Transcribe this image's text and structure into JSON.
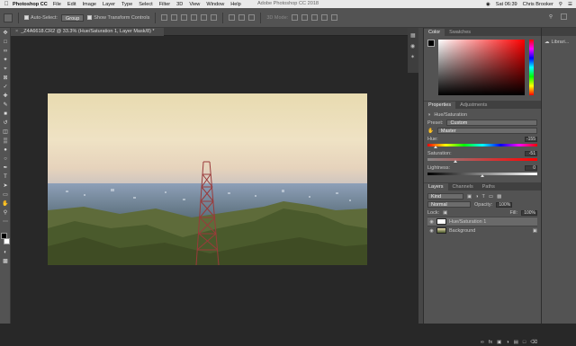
{
  "menubar": {
    "apple": "",
    "app_name": "Photoshop CC",
    "items": [
      "File",
      "Edit",
      "Image",
      "Layer",
      "Type",
      "Select",
      "Filter",
      "3D",
      "View",
      "Window",
      "Help"
    ],
    "center_title": "Adobe Photoshop CC 2018",
    "clock": "Sat 06:39",
    "user": "Chris Brooker"
  },
  "options": {
    "auto_select_label": "Auto-Select:",
    "auto_select_value": "Group",
    "transform_label": "Show Transform Controls",
    "mode_3d": "3D Mode:"
  },
  "document": {
    "tab_title": "_Z4A6618.CR2 @ 33.3% (Hue/Saturation 1, Layer Mask/8) *"
  },
  "color_panel": {
    "tabs": [
      "Color",
      "Swatches"
    ]
  },
  "properties_panel": {
    "tabs": [
      "Properties",
      "Adjustments"
    ],
    "adjustment_name": "Hue/Saturation",
    "preset_label": "Preset:",
    "preset_value": "Custom",
    "channel_value": "Master",
    "hue_label": "Hue:",
    "hue_value": "-155",
    "hue_fraction": 0.07,
    "saturation_label": "Saturation:",
    "saturation_value": "-51",
    "saturation_fraction": 0.25,
    "lightness_label": "Lightness:",
    "lightness_value": "0",
    "lightness_fraction": 0.5
  },
  "layers_panel": {
    "tabs": [
      "Layers",
      "Channels",
      "Paths"
    ],
    "kind_label": "Kind",
    "blend_mode": "Normal",
    "opacity_label": "Opacity:",
    "opacity_value": "100%",
    "lock_label": "Lock:",
    "fill_label": "Fill:",
    "fill_value": "100%",
    "layers": [
      {
        "name": "Hue/Saturation 1",
        "selected": true
      },
      {
        "name": "Background",
        "selected": false
      }
    ]
  },
  "libraries": {
    "label": "Librari..."
  },
  "colors": {
    "accent": "#2d8ceb",
    "panel_bg": "#535353"
  }
}
